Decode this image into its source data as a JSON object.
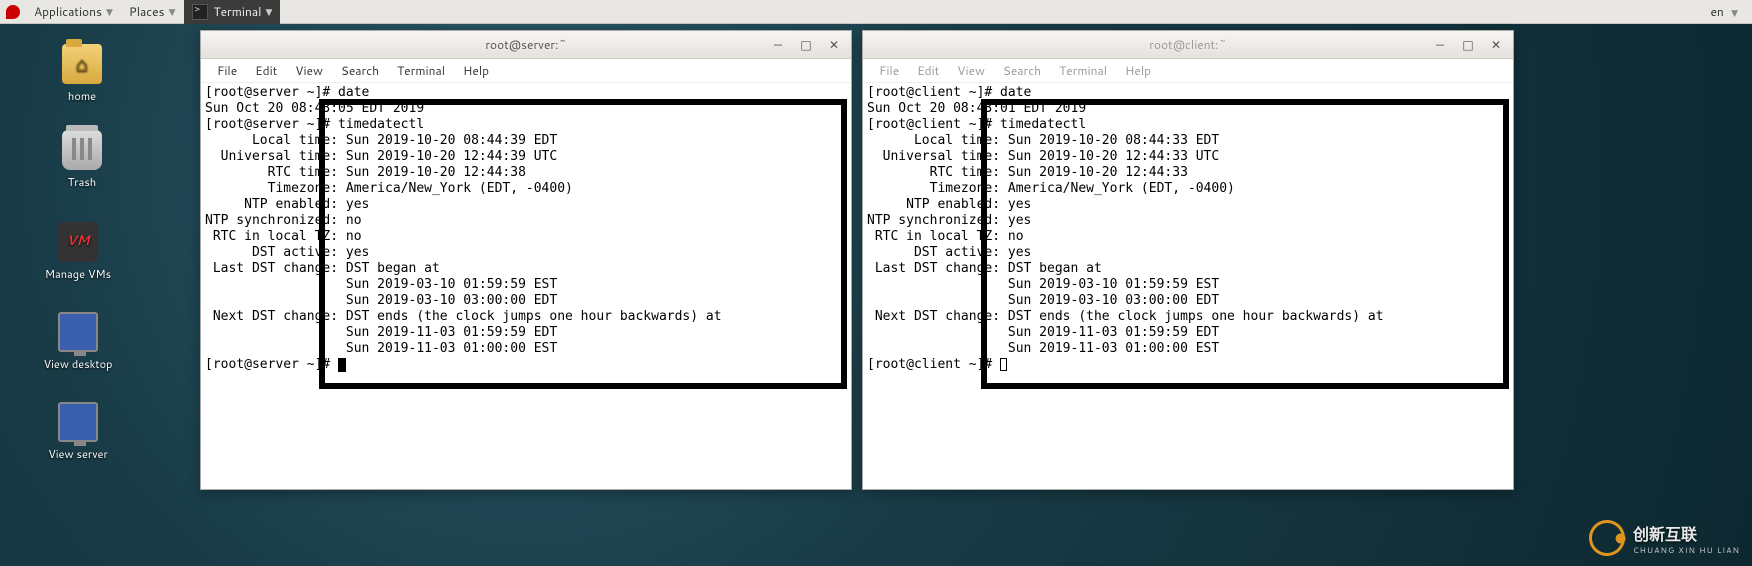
{
  "panel": {
    "applications": "Applications",
    "places": "Places",
    "terminal": "Terminal",
    "lang": "en"
  },
  "desktop_icons": {
    "home": "home",
    "trash": "Trash",
    "manage_vms": "Manage VMs",
    "view_desktop": "View desktop",
    "view_server": "View server"
  },
  "win_server": {
    "title": "root@server:~",
    "menus": {
      "file": "File",
      "edit": "Edit",
      "view": "View",
      "search": "Search",
      "terminal": "Terminal",
      "help": "Help"
    },
    "lines": [
      "[root@server ~]# date",
      "Sun Oct 20 08:43:05 EDT 2019",
      "[root@server ~]# timedatectl",
      "      Local time: Sun 2019-10-20 08:44:39 EDT",
      "  Universal time: Sun 2019-10-20 12:44:39 UTC",
      "        RTC time: Sun 2019-10-20 12:44:38",
      "        Timezone: America/New_York (EDT, -0400)",
      "     NTP enabled: yes",
      "NTP synchronized: no",
      " RTC in local TZ: no",
      "      DST active: yes",
      " Last DST change: DST began at",
      "                  Sun 2019-03-10 01:59:59 EST",
      "                  Sun 2019-03-10 03:00:00 EDT",
      " Next DST change: DST ends (the clock jumps one hour backwards) at",
      "                  Sun 2019-11-03 01:59:59 EDT",
      "                  Sun 2019-11-03 01:00:00 EST",
      "[root@server ~]# "
    ]
  },
  "win_client": {
    "title": "root@client:~",
    "menus": {
      "file": "File",
      "edit": "Edit",
      "view": "View",
      "search": "Search",
      "terminal": "Terminal",
      "help": "Help"
    },
    "lines": [
      "[root@client ~]# date",
      "Sun Oct 20 08:43:01 EDT 2019",
      "[root@client ~]# timedatectl",
      "      Local time: Sun 2019-10-20 08:44:33 EDT",
      "  Universal time: Sun 2019-10-20 12:44:33 UTC",
      "        RTC time: Sun 2019-10-20 12:44:33",
      "        Timezone: America/New_York (EDT, -0400)",
      "     NTP enabled: yes",
      "NTP synchronized: yes",
      " RTC in local TZ: no",
      "      DST active: yes",
      " Last DST change: DST began at",
      "                  Sun 2019-03-10 01:59:59 EST",
      "                  Sun 2019-03-10 03:00:00 EDT",
      " Next DST change: DST ends (the clock jumps one hour backwards) at",
      "                  Sun 2019-11-03 01:59:59 EDT",
      "                  Sun 2019-11-03 01:00:00 EST",
      "[root@client ~]# "
    ]
  },
  "watermark": {
    "main": "创新互联",
    "sub": "CHUANG XIN HU LIAN"
  }
}
